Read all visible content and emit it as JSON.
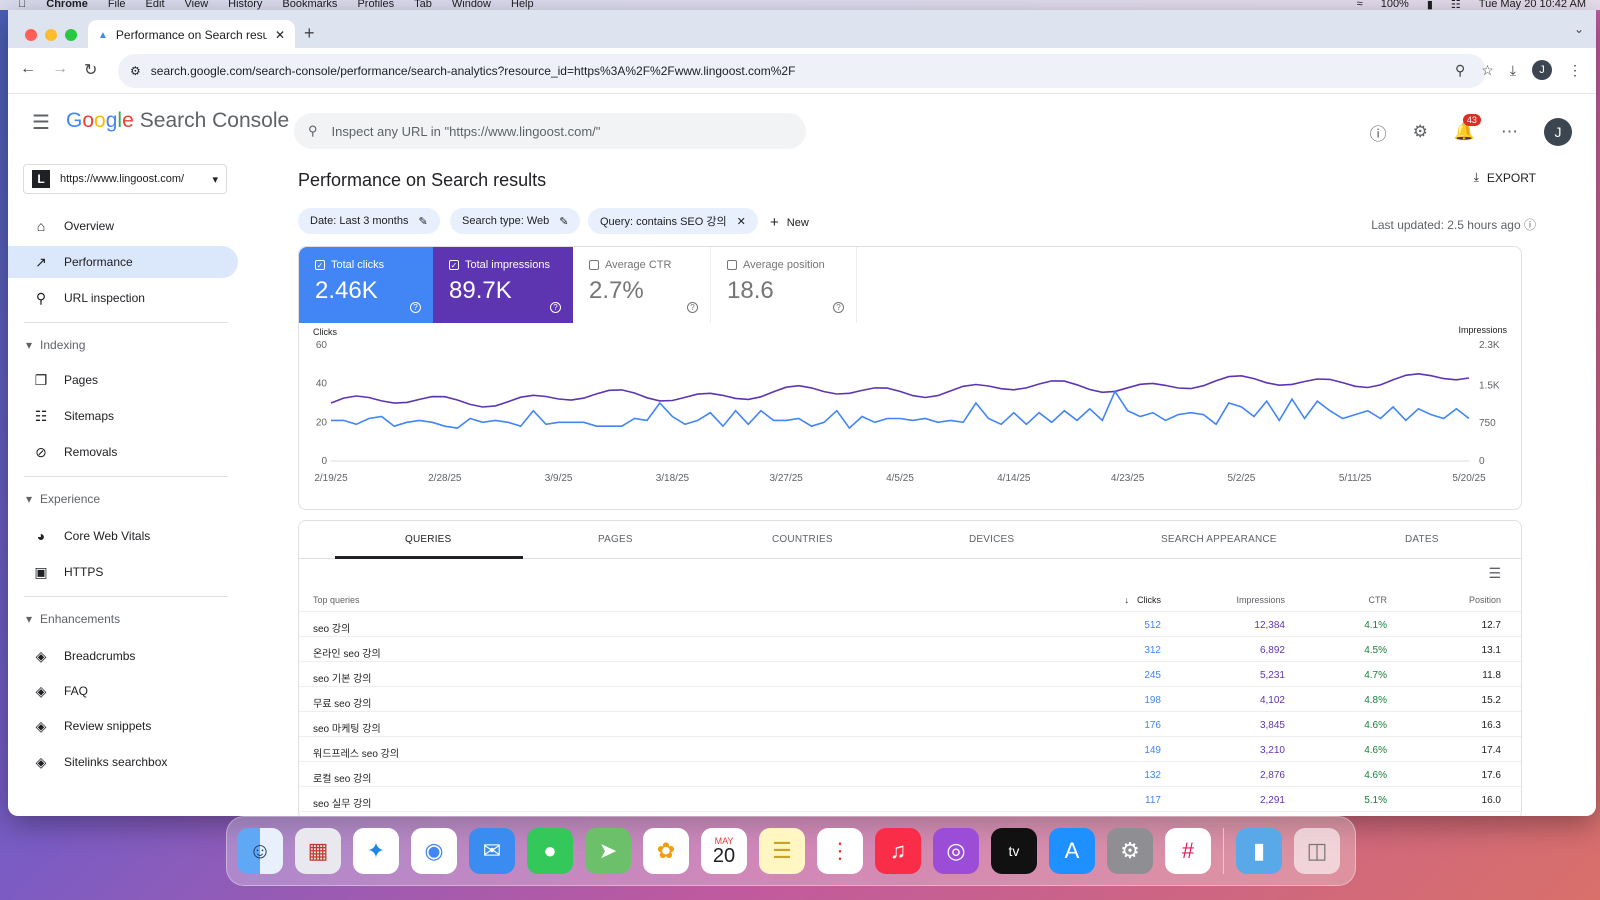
{
  "menubar": {
    "apple": "",
    "items": [
      "Chrome",
      "File",
      "Edit",
      "View",
      "History",
      "Bookmarks",
      "Profiles",
      "Tab",
      "Window",
      "Help"
    ],
    "battery": "100%",
    "datetime": "Tue May 20  10:42 AM"
  },
  "browser": {
    "tab_title": "Performance on Search results",
    "url": "search.google.com/search-console/performance/search-analytics?resource_id=https%3A%2F%2Fwww.lingoost.com%2F",
    "profile_initial": "J"
  },
  "app": {
    "logo": {
      "g1": "G",
      "g2": "o",
      "g3": "o",
      "g4": "g",
      "g5": "l",
      "g6": "e",
      "suffix": "Search Console"
    },
    "search_placeholder": "Inspect any URL in \"https://www.lingoost.com/\"",
    "notifications_count": "43",
    "user_initial": "J",
    "property": {
      "logo_letter": "L",
      "url": "https://www.lingoost.com/"
    }
  },
  "sidebar": {
    "overview": "Overview",
    "performance": "Performance",
    "url_inspection": "URL inspection",
    "indexing": "Indexing",
    "pages": "Pages",
    "sitemaps": "Sitemaps",
    "removals": "Removals",
    "experience": "Experience",
    "core_web_vitals": "Core Web Vitals",
    "https": "HTTPS",
    "enhancements": "Enhancements",
    "breadcrumbs": "Breadcrumbs",
    "faq": "FAQ",
    "review_snippets": "Review snippets",
    "sitelinks_searchbox": "Sitelinks searchbox"
  },
  "main": {
    "title": "Performance on Search results",
    "export": "EXPORT",
    "filters": {
      "date": "Date: Last 3 months",
      "search_type": "Search type: Web",
      "query": "Query: contains SEO 강의",
      "new": "New"
    },
    "last_updated": "Last updated: 2.5 hours ago"
  },
  "metrics": {
    "clicks_label": "Total clicks",
    "clicks_value": "2.46K",
    "impressions_label": "Total impressions",
    "impressions_value": "89.7K",
    "ctr_label": "Average CTR",
    "ctr_value": "2.7%",
    "position_label": "Average position",
    "position_value": "18.6",
    "clicks_checked": true,
    "impressions_checked": true,
    "ctr_checked": false,
    "position_checked": false
  },
  "chart_data": {
    "type": "line",
    "left_axis_label": "Clicks",
    "right_axis_label": "Impressions",
    "left_ticks": [
      "60",
      "40",
      "20",
      "0"
    ],
    "left_tick_values": [
      60,
      40,
      20,
      0
    ],
    "right_ticks": [
      "2.3K",
      "1.5K",
      "750",
      "0"
    ],
    "right_tick_values": [
      2300,
      1500,
      750,
      0
    ],
    "ylim_left": [
      0,
      60
    ],
    "ylim_right": [
      0,
      2300
    ],
    "x_tick_labels": [
      "2/19/25",
      "2/28/25",
      "3/9/25",
      "3/18/25",
      "3/27/25",
      "4/5/25",
      "4/14/25",
      "4/23/25",
      "5/2/25",
      "5/11/25",
      "5/20/25"
    ],
    "x_start": "2025-02-19",
    "x_end": "2025-05-20",
    "colors": {
      "clicks": "#4285f4",
      "impressions": "#5e35b1"
    },
    "series": [
      {
        "name": "Clicks",
        "axis": "left",
        "values": [
          21,
          18,
          21,
          21,
          21,
          19,
          22,
          25,
          22,
          18,
          20,
          23,
          22,
          17,
          18,
          20,
          20,
          22,
          21,
          21,
          22,
          23,
          20,
          22,
          16,
          18,
          33,
          20,
          17,
          21,
          22,
          21,
          23,
          20,
          19,
          22,
          21,
          23,
          21,
          20,
          19,
          25,
          18,
          19,
          22,
          26,
          21,
          19,
          20,
          18,
          20,
          23,
          21,
          20,
          19,
          21,
          20,
          19,
          25,
          18,
          21,
          18,
          20,
          17,
          18,
          21,
          19,
          22,
          25,
          22,
          21,
          18,
          19,
          30,
          38,
          23,
          20,
          21,
          19,
          20,
          23,
          21,
          18,
          38,
          25,
          20,
          20,
          18,
          21,
          20,
          26,
          19,
          19,
          18,
          19,
          26,
          20,
          23,
          21,
          20,
          19,
          21,
          20,
          22,
          22,
          20,
          18,
          23,
          22,
          20,
          21,
          22,
          26,
          25,
          27,
          17,
          18,
          24,
          23,
          20,
          20,
          20,
          22,
          22,
          25,
          23,
          22,
          21,
          18,
          21,
          20,
          20,
          22,
          23,
          21,
          20,
          19,
          21,
          22,
          22,
          20,
          22,
          24,
          30,
          33,
          20,
          22,
          30,
          24,
          19,
          21,
          25,
          24,
          22,
          19,
          20,
          22,
          25,
          26,
          23,
          20,
          21,
          24,
          26,
          19,
          21,
          22,
          25,
          27,
          24,
          20,
          21,
          24,
          29,
          36,
          27,
          22,
          26,
          27,
          28,
          23,
          25,
          25,
          21,
          19,
          21,
          26,
          28,
          24,
          22,
          23,
          25,
          26,
          27,
          24,
          20,
          19,
          28,
          35,
          30,
          22,
          24,
          28,
          30,
          24,
          23,
          26,
          29,
          31,
          26,
          21,
          22,
          27,
          32,
          29,
          23,
          22,
          25,
          27,
          31,
          24,
          22,
          26,
          29,
          27,
          22,
          21,
          24,
          28,
          31,
          26,
          21,
          20,
          22,
          27,
          30,
          28,
          23,
          20,
          21,
          24,
          27,
          25,
          23,
          24,
          26,
          28,
          22,
          21,
          23,
          27,
          26,
          24,
          22,
          24,
          28
        ]
      },
      {
        "name": "Impressions",
        "axis": "left",
        "values": []
      }
    ]
  },
  "table": {
    "tabs": [
      "QUERIES",
      "PAGES",
      "COUNTRIES",
      "DEVICES",
      "SEARCH APPEARANCE",
      "DATES"
    ],
    "headers": {
      "query": "Top queries",
      "clicks": "Clicks",
      "impressions": "Impressions",
      "ctr": "CTR",
      "position": "Position"
    },
    "rows": [
      {
        "query": "seo 강의",
        "clicks": "512",
        "impressions": "12,384",
        "ctr": "4.1%",
        "position": "12.7"
      },
      {
        "query": "온라인 seo 강의",
        "clicks": "312",
        "impressions": "6,892",
        "ctr": "4.5%",
        "position": "13.1"
      },
      {
        "query": "seo 기본 강의",
        "clicks": "245",
        "impressions": "5,231",
        "ctr": "4.7%",
        "position": "11.8"
      },
      {
        "query": "무료 seo 강의",
        "clicks": "198",
        "impressions": "4,102",
        "ctr": "4.8%",
        "position": "15.2"
      },
      {
        "query": "seo 마케팅 강의",
        "clicks": "176",
        "impressions": "3,845",
        "ctr": "4.6%",
        "position": "16.3"
      },
      {
        "query": "워드프레스 seo 강의",
        "clicks": "149",
        "impressions": "3,210",
        "ctr": "4.6%",
        "position": "17.4"
      },
      {
        "query": "로컬 seo 강의",
        "clicks": "132",
        "impressions": "2,876",
        "ctr": "4.6%",
        "position": "17.6"
      },
      {
        "query": "seo 실무 강의",
        "clicks": "117",
        "impressions": "2,291",
        "ctr": "5.1%",
        "position": "16.0"
      }
    ]
  },
  "dock": {
    "calendar_month": "MAY",
    "calendar_day": "20",
    "apps": [
      "finder-icon",
      "launchpad-icon",
      "safari-icon",
      "chrome-icon",
      "mail-icon",
      "messages-icon",
      "maps-icon",
      "photos-icon",
      "calendar-icon",
      "notes-icon",
      "reminders-icon",
      "music-icon",
      "podcasts-icon",
      "tv-icon",
      "app-store-icon",
      "settings-icon",
      "slack-icon",
      "folder-icon",
      "trash-icon"
    ]
  }
}
